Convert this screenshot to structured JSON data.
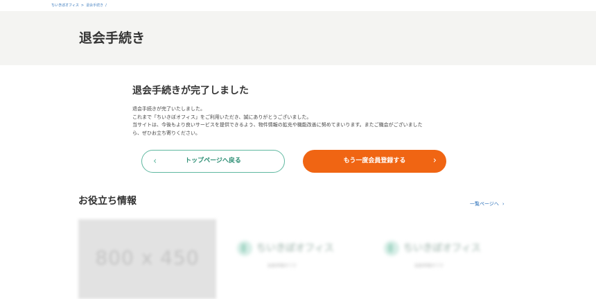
{
  "breadcrumb": {
    "items": [
      "ちいきぼオフィス",
      "退会手続き"
    ],
    "separator": ">",
    "trailing": "/"
  },
  "header": {
    "title": "退会手続き"
  },
  "completion": {
    "heading": "退会手続きが完了しました",
    "lines": [
      "退会手続きが完了いたしました。",
      "これまで「ちいきぼオフィス」をご利用いただき、誠にありがとうございました。",
      "当サイトは、今後もより良いサービスを提供できるよう、物件情報の拡充や機能改善に努めてまいります。またご機会がございました",
      "ら、ぜひお立ち寄りください。"
    ]
  },
  "buttons": {
    "back_label": "トップページへ戻る",
    "register_label": "もう一度会員登録する",
    "chevron_left": "‹",
    "chevron_right": "›"
  },
  "useful": {
    "heading": "お役立ち情報",
    "view_all_label": "一覧ページへ",
    "view_all_chevron": "›",
    "cards": [
      {
        "thumbnail_placeholder": "800 x 450",
        "brand": "",
        "sub": ""
      },
      {
        "thumbnail_placeholder": "",
        "brand": "ちいきぼオフィス",
        "sub": "画像準備中です"
      },
      {
        "thumbnail_placeholder": "",
        "brand": "ちいきぼオフィス",
        "sub": "画像準備中です"
      }
    ]
  },
  "colors": {
    "accent_orange": "#f06513",
    "accent_green": "#5fb8a0",
    "link_blue": "#2a6fb8",
    "header_band": "#f4f4f2"
  },
  "icons": {
    "back_button": "chevron-left-icon",
    "register_button": "chevron-right-icon",
    "view_all": "chevron-right-icon",
    "card_logo": "logo-mark-icon"
  }
}
